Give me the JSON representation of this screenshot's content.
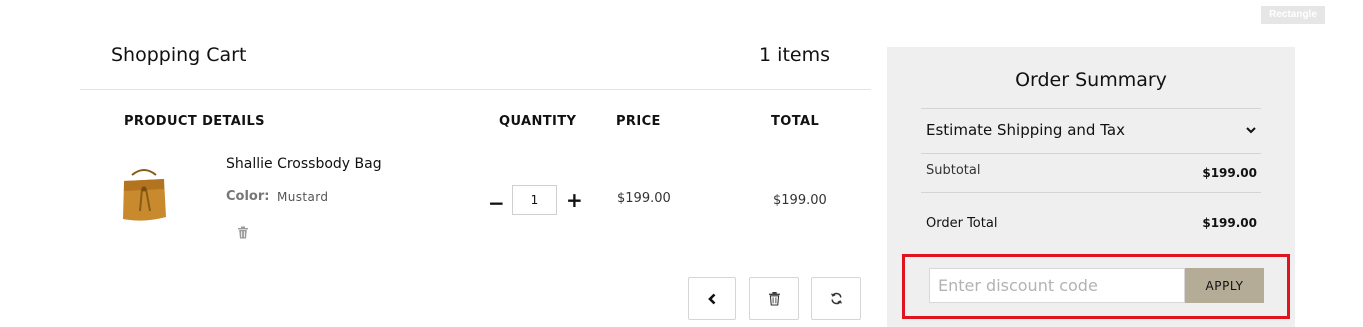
{
  "overlay_tag": "Rectangle",
  "cart": {
    "title": "Shopping Cart",
    "count_label": "1 items",
    "columns": [
      "PRODUCT DETAILS",
      "QUANTITY",
      "PRICE",
      "TOTAL"
    ],
    "item": {
      "name": "Shallie Crossbody Bag",
      "color_label": "Color:",
      "color_value": "Mustard",
      "quantity": "1",
      "price": "$199.00",
      "total": "$199.00",
      "minus_label": "−",
      "plus_label": "+"
    },
    "colors": {
      "bag": "#c98a2e",
      "bag_dark": "#9c6417"
    }
  },
  "summary": {
    "title": "Order Summary",
    "shipping_label": "Estimate Shipping and Tax",
    "subtotal_label": "Subtotal",
    "subtotal_value": "$199.00",
    "order_total_label": "Order Total",
    "order_total_value": "$199.00",
    "discount_placeholder": "Enter discount code",
    "apply_label": "APPLY",
    "colors": {
      "highlight": "#e0141e",
      "apply_bg": "#b5ac98",
      "panel_bg": "#efefef"
    }
  },
  "icons": [
    "trash-icon",
    "chevron-left-icon",
    "refresh-icon",
    "chevron-down-icon"
  ]
}
